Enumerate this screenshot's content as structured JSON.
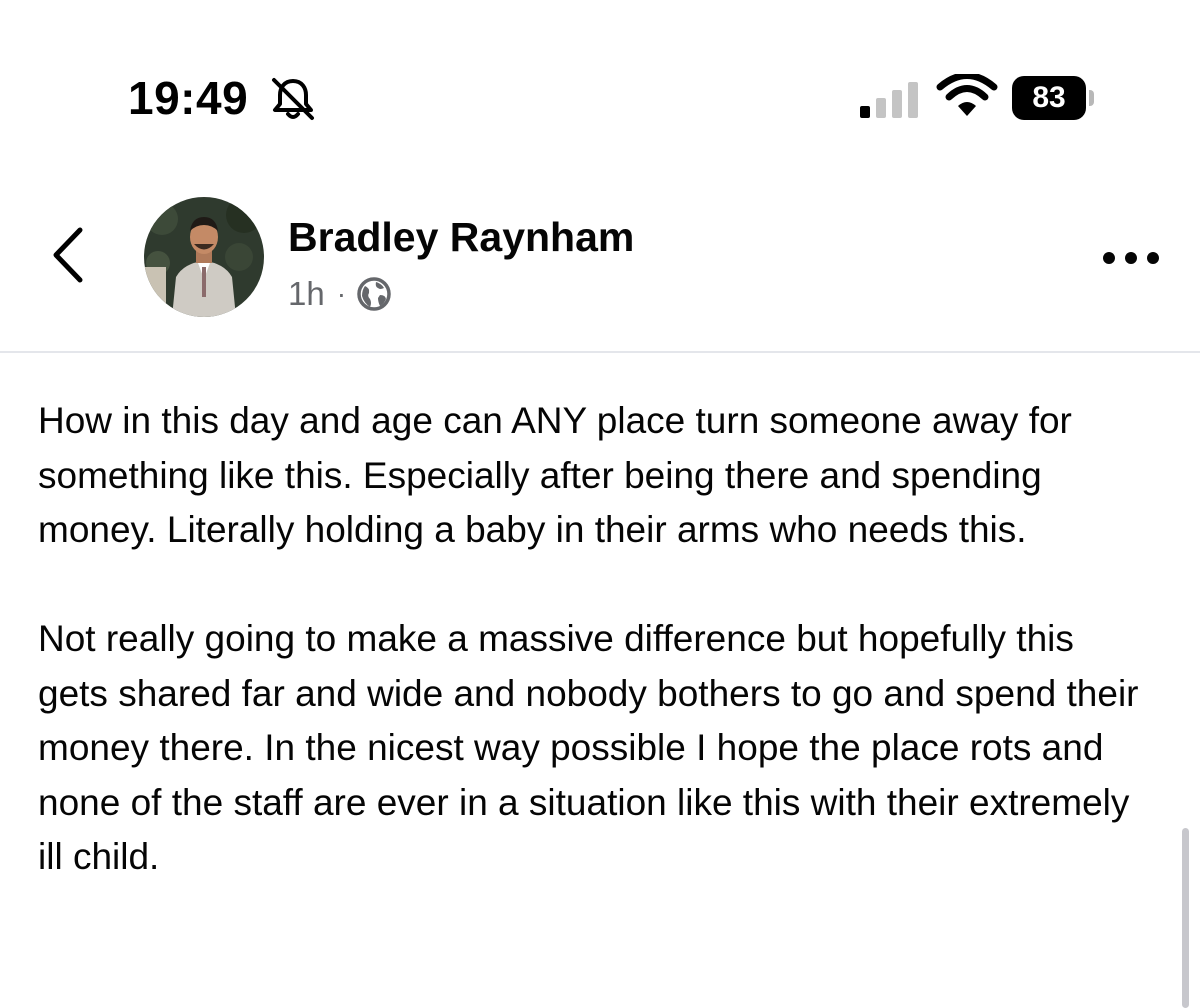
{
  "status_bar": {
    "time": "19:49",
    "battery_percent": "83",
    "icons": [
      "bell-off-icon",
      "cellular-signal-icon",
      "wifi-icon",
      "battery-icon"
    ],
    "signal_bars_active": 1,
    "signal_bars_total": 4
  },
  "post": {
    "author_name": "Bradley Raynham",
    "time_ago": "1h",
    "separator": "·",
    "audience_icon": "globe-icon",
    "paragraphs": [
      "How in this day and age can ANY place turn someone away for something like this. Especially after being there and spending money. Literally holding a baby in their arms who needs this.",
      "Not really going to make a massive difference but hopefully this gets shared far and wide and nobody bothers to go and spend their money there. In the nicest way possible I hope the place rots and none of the staff are ever in a situation like this with their extremely ill child."
    ]
  },
  "header_icons": {
    "back": "chevron-left-icon",
    "more": "more-horizontal-icon"
  },
  "colors": {
    "text_primary": "#050505",
    "text_secondary": "#65676b",
    "divider": "#e4e6eb",
    "background": "#ffffff"
  }
}
